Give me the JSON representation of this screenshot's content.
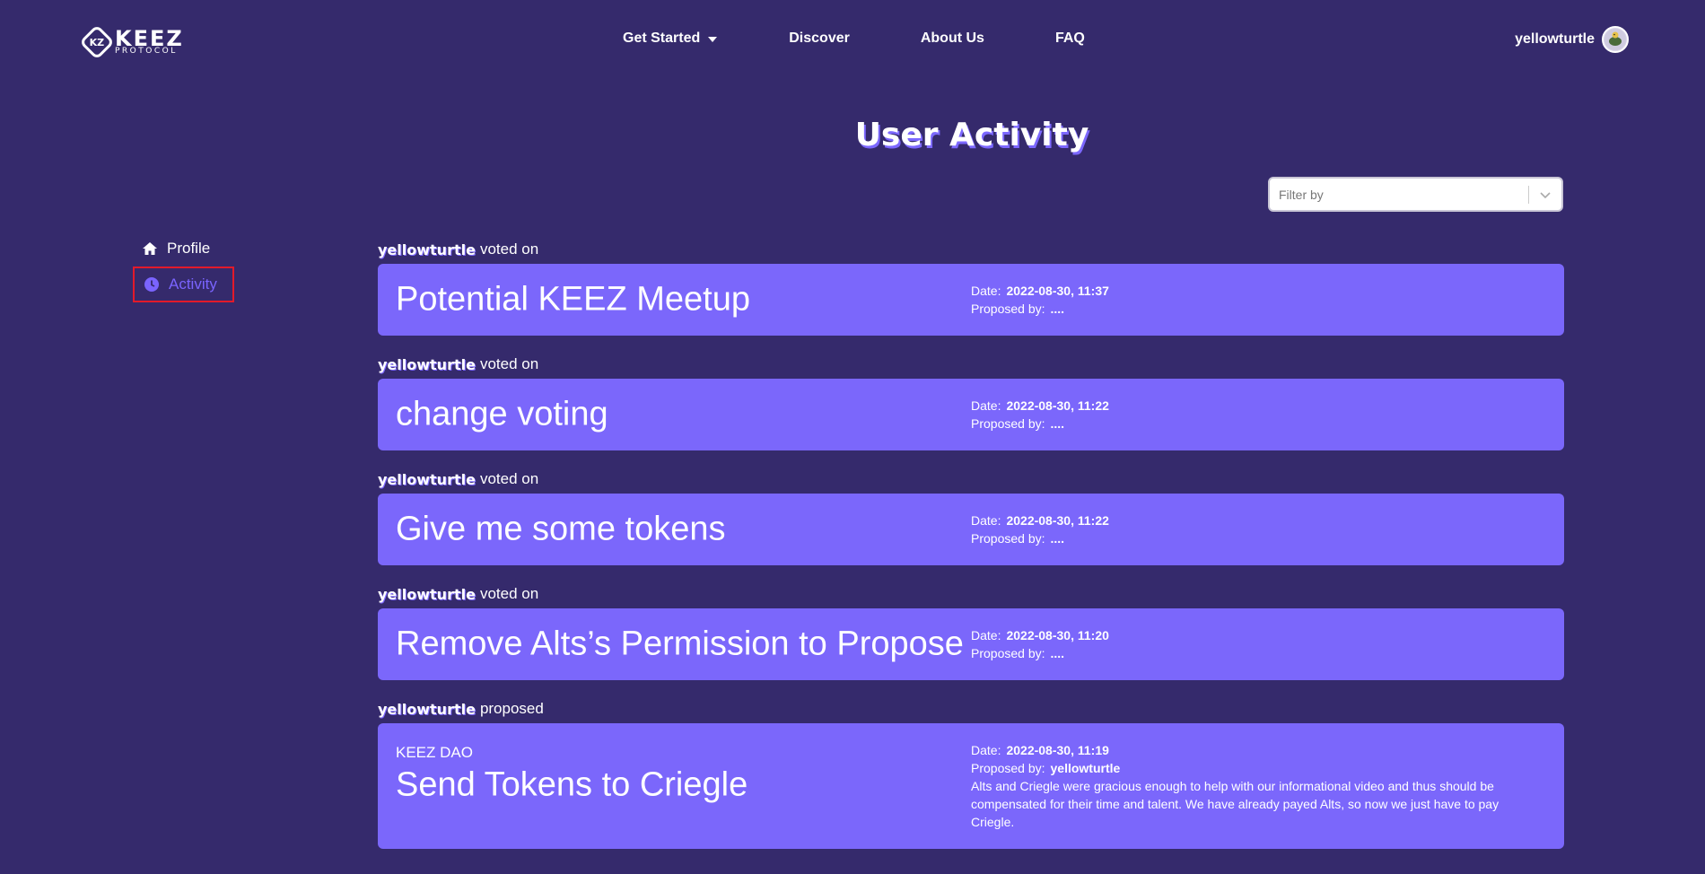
{
  "logo": {
    "line1": "KEEZ",
    "line2": "PROTOCOL",
    "mark": "KZ"
  },
  "nav": {
    "get_started": "Get Started",
    "discover": "Discover",
    "about": "About Us",
    "faq": "FAQ"
  },
  "user": {
    "name": "yellowturtle"
  },
  "page": {
    "title": "User Activity"
  },
  "filter": {
    "placeholder": "Filter by"
  },
  "sidebar": {
    "items": [
      {
        "label": "Profile",
        "icon": "home-icon"
      },
      {
        "label": "Activity",
        "icon": "clock-icon"
      }
    ]
  },
  "labels": {
    "date": "Date:",
    "proposed_by": "Proposed by:"
  },
  "feed": [
    {
      "user": "yellowturtle",
      "action": "voted on",
      "title": "Potential KEEZ Meetup",
      "date": "2022-08-30, 11:37",
      "proposer": "...."
    },
    {
      "user": "yellowturtle",
      "action": "voted on",
      "title": "change voting",
      "date": "2022-08-30, 11:22",
      "proposer": "...."
    },
    {
      "user": "yellowturtle",
      "action": "voted on",
      "title": "Give me some tokens",
      "date": "2022-08-30, 11:22",
      "proposer": "...."
    },
    {
      "user": "yellowturtle",
      "action": "voted on",
      "title": "Remove Alts’s Permission to Propose",
      "date": "2022-08-30, 11:20",
      "proposer": "...."
    },
    {
      "user": "yellowturtle",
      "action": "proposed",
      "dao": "KEEZ DAO",
      "title": "Send Tokens to Criegle",
      "date": "2022-08-30, 11:19",
      "proposer": "yellowturtle",
      "description": "Alts and Criegle were gracious enough to help with our informational video and thus should be compensated for their time and talent. We have already payed Alts, so now we just have to pay Criegle."
    }
  ],
  "colors": {
    "background": "#352a6c",
    "card": "#7b67fb",
    "accent": "#7a64ff",
    "highlight_border": "#e21a2a"
  }
}
